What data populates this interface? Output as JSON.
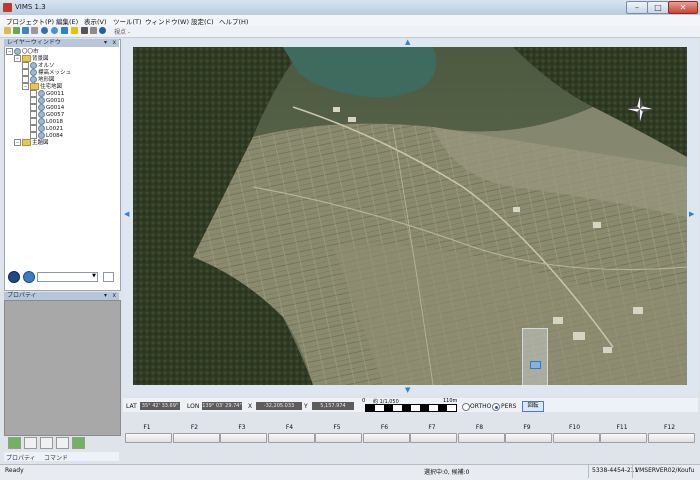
{
  "window": {
    "title": "VIMS 1.3",
    "min": "–",
    "max": "□",
    "close": "✕"
  },
  "menu": [
    "プロジェクト(P)",
    "編集(E)",
    "表示(V)",
    "ツール(T)",
    "ウィンドウ(W)",
    "設定(C)",
    "ヘルプ(H)"
  ],
  "toolbar": {
    "viewpoint_label": "視点 -",
    "icons": [
      "folder-open-icon",
      "refresh-icon",
      "layers-icon",
      "import-icon",
      "globe-icon",
      "info-icon",
      "shield-icon",
      "pointer-icon",
      "binoculars-icon",
      "tools-icon",
      "clock-icon",
      "help-icon"
    ]
  },
  "layer_panel": {
    "title": "レイヤーウィンドウ",
    "pin": "📌",
    "close": "x",
    "tree": [
      {
        "level": 0,
        "label": "〇〇市",
        "kind": "globe"
      },
      {
        "level": 1,
        "label": "背景図",
        "kind": "folder"
      },
      {
        "level": 2,
        "label": "オルソ",
        "kind": "globe"
      },
      {
        "level": 2,
        "label": "標高メッシュ",
        "kind": "globe"
      },
      {
        "level": 2,
        "label": "地形図",
        "kind": "globe"
      },
      {
        "level": 2,
        "label": "住宅地図",
        "kind": "folder"
      },
      {
        "level": 3,
        "label": "G0011",
        "kind": "globe"
      },
      {
        "level": 3,
        "label": "G0010",
        "kind": "globe"
      },
      {
        "level": 3,
        "label": "G0014",
        "kind": "globe"
      },
      {
        "level": 3,
        "label": "G0057",
        "kind": "globe"
      },
      {
        "level": 3,
        "label": "L0018",
        "kind": "globe"
      },
      {
        "level": 3,
        "label": "L0021",
        "kind": "globe"
      },
      {
        "level": 3,
        "label": "L0084",
        "kind": "globe"
      },
      {
        "level": 1,
        "label": "主題図",
        "kind": "folder"
      }
    ],
    "select_value": ""
  },
  "prop_panel": {
    "title": "プロパティ",
    "pin": "📌",
    "close": "x"
  },
  "tabs": [
    {
      "label": "プロパティ"
    },
    {
      "label": "コマンド"
    }
  ],
  "coords": {
    "lat_label": "LAT",
    "lat_value": "35° 42' 33.69\"",
    "lon_label": "LON",
    "lon_value": "139° 03' 29.74\"",
    "x_label": "X",
    "x_value": "-32,205.033",
    "y_label": "Y",
    "y_value": "5,157.974",
    "scale_zero": "0",
    "scale_text": "約 1/1,050",
    "scale_end": "110m",
    "mode_ortho": "ORTHO",
    "mode_pers": "PERS",
    "nav_button": "回転"
  },
  "fkeys": [
    "F1",
    "F2",
    "F3",
    "F4",
    "F5",
    "F6",
    "F7",
    "F8",
    "F9",
    "F10",
    "F11",
    "F12"
  ],
  "status": {
    "ready": "Ready",
    "selection": "選択中:0, 候補:0",
    "mesh": "5338-4454-211",
    "server": "VMSERVER02/Koufu"
  },
  "colors": {
    "accent": "#2f7fd0",
    "panel_header": "#b8c6d9"
  }
}
